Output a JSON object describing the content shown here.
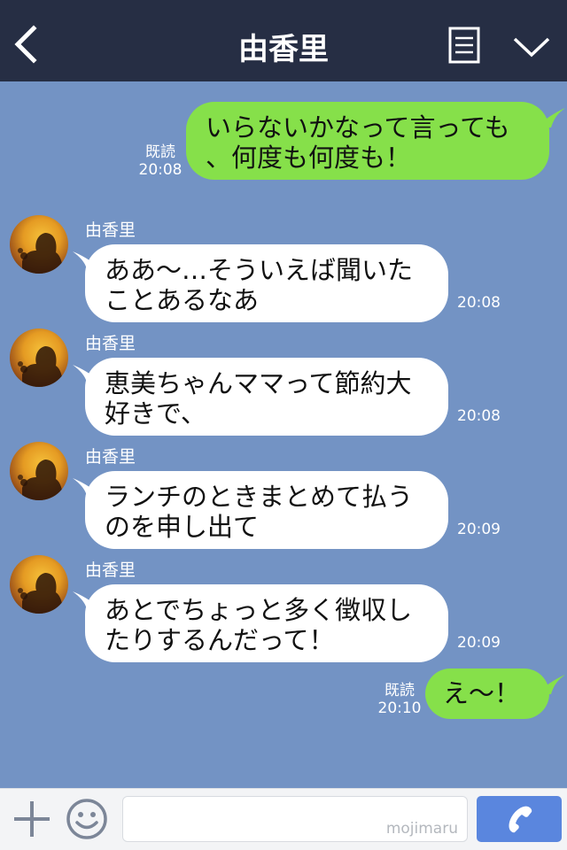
{
  "header": {
    "title": "由香里"
  },
  "messages": [
    {
      "kind": "out",
      "lines": "いらないかなって言っても\n、何度も何度も！",
      "read_label": "既読",
      "time": "20:08"
    },
    {
      "kind": "in",
      "sender": "由香里",
      "lines": "ああ〜…そういえば聞いた\nことあるなあ",
      "time": "20:08"
    },
    {
      "kind": "in",
      "sender": "由香里",
      "lines": "恵美ちゃんママって節約大\n好きで、",
      "time": "20:08"
    },
    {
      "kind": "in",
      "sender": "由香里",
      "lines": "ランチのときまとめて払う\nのを申し出て",
      "time": "20:09"
    },
    {
      "kind": "in",
      "sender": "由香里",
      "lines": "あとでちょっと多く徴収し\nたりするんだって！",
      "time": "20:09"
    },
    {
      "kind": "out",
      "lines": "え〜！",
      "read_label": "既読",
      "time": "20:10"
    }
  ],
  "input": {
    "placeholder": "",
    "watermark": "mojimaru"
  },
  "colors": {
    "header_bg": "#262e44",
    "chat_bg": "#7393c4",
    "out_bubble": "#86e04a",
    "in_bubble": "#ffffff",
    "call_button": "#5a86de"
  },
  "icons": {
    "back": "chevron-left-icon",
    "menu": "document-menu-icon",
    "collapse": "chevron-down-icon",
    "add": "plus-icon",
    "sticker": "smiley-icon",
    "call": "phone-icon"
  }
}
